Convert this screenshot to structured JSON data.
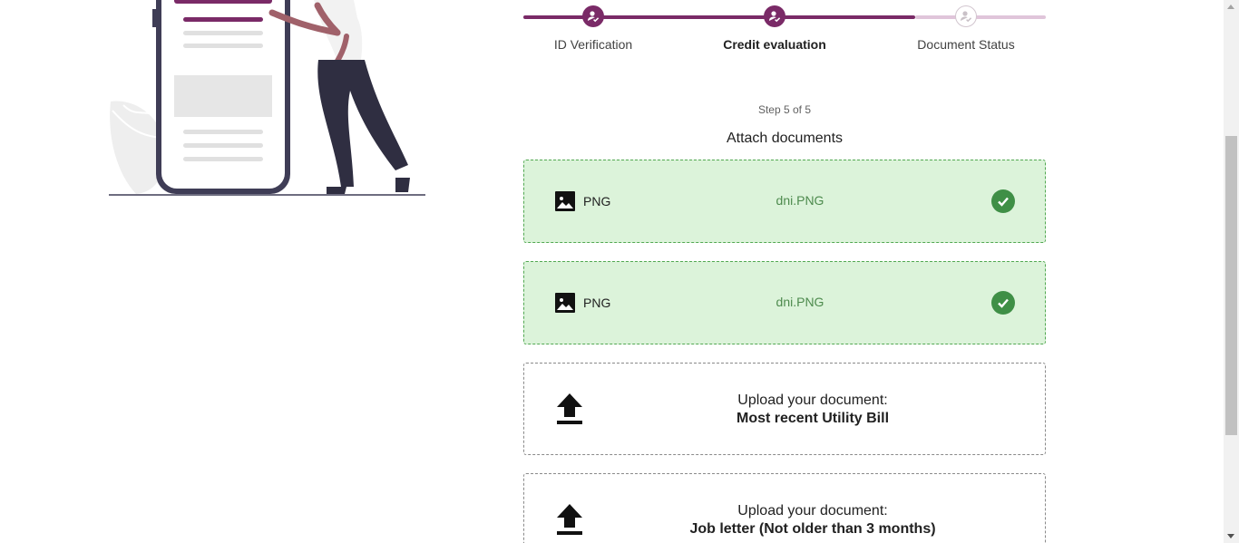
{
  "stepper": {
    "steps": [
      {
        "label": "ID Verification",
        "state": "done"
      },
      {
        "label": "Credit evaluation",
        "state": "current"
      },
      {
        "label": "Document Status",
        "state": "pending"
      }
    ],
    "step_count": "Step 5 of 5",
    "accent_color": "#7a2a67"
  },
  "attach": {
    "title": "Attach documents",
    "uploaded": [
      {
        "type": "PNG",
        "file_name": "dni.PNG",
        "icon": "image-icon",
        "status_icon": "check-circle-icon"
      },
      {
        "type": "PNG",
        "file_name": "dni.PNG",
        "icon": "image-icon",
        "status_icon": "check-circle-icon"
      }
    ],
    "pending": [
      {
        "prompt": "Upload your document:",
        "document": "Most recent Utility Bill",
        "icon": "upload-icon"
      },
      {
        "prompt": "Upload your document:",
        "document": "Job letter (Not older than 3 months)",
        "icon": "upload-icon"
      }
    ]
  }
}
